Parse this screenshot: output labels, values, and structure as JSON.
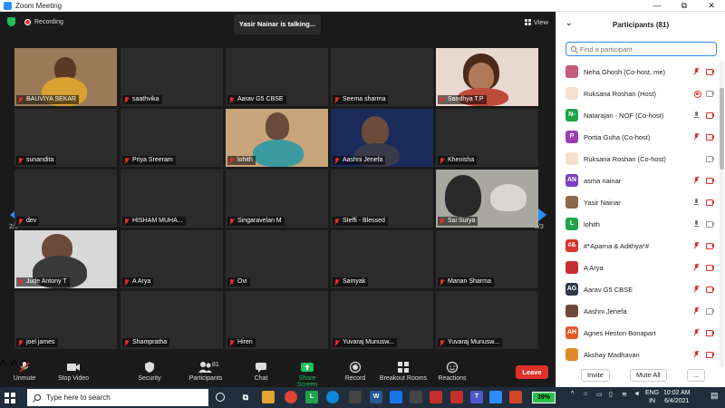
{
  "window": {
    "title": "Zoom Meeting",
    "ctrls": [
      "—",
      "⧉",
      "✕"
    ]
  },
  "meeting": {
    "recording_label": "Recording",
    "talking_banner": "Yasir Nainar is talking...",
    "view_label": "View",
    "page_left": "2/3",
    "page_right": "2/3"
  },
  "tiles": [
    {
      "name": "BAUVIYA SEKAR",
      "video": true
    },
    {
      "name": "saathvika",
      "video": false
    },
    {
      "name": "Aarav G5 CBSE",
      "video": false
    },
    {
      "name": "Seema sharma",
      "video": false
    },
    {
      "name": "Sandhya T.P",
      "video": true
    },
    {
      "name": "sunandita",
      "video": false
    },
    {
      "name": "Priya Sreeram",
      "video": false
    },
    {
      "name": "lohith",
      "video": true
    },
    {
      "name": "Aashni Jenefa",
      "video": true
    },
    {
      "name": "Khenisha",
      "video": false
    },
    {
      "name": "dev",
      "video": false
    },
    {
      "name": "HISHAM MUHA...",
      "video": false
    },
    {
      "name": "Singaravelan M",
      "video": false
    },
    {
      "name": "Steffi - Blessed",
      "video": false
    },
    {
      "name": "Sai Surya",
      "video": true
    },
    {
      "name": "Jude Antony T",
      "video": true
    },
    {
      "name": "A Arya",
      "video": false
    },
    {
      "name": "Ovi",
      "video": false
    },
    {
      "name": "Samyak",
      "video": false
    },
    {
      "name": "Manan Sharma",
      "video": false
    },
    {
      "name": "joel james",
      "video": false
    },
    {
      "name": "Shampratha",
      "video": false
    },
    {
      "name": "Hiren",
      "video": false
    },
    {
      "name": "Yuvaraj Munusw...",
      "video": false
    },
    {
      "name": "Yuvaraj Munusw...",
      "video": false
    }
  ],
  "toolbar": {
    "unmute": "Unmute",
    "stop_video": "Stop Video",
    "security": "Security",
    "participants": "Participants",
    "participants_count": "81",
    "chat": "Chat",
    "share_screen": "Share Screen",
    "record": "Record",
    "breakout": "Breakout Rooms",
    "reactions": "Reactions",
    "leave": "Leave"
  },
  "panel": {
    "title": "Participants (81)",
    "search_placeholder": "Find a participant",
    "invite": "Invite",
    "mute_all": "Mute All",
    "more": "...",
    "participants": [
      {
        "name": "Neha Ghosh (Co-host, me)",
        "avatar": "",
        "color": "#c75b7a",
        "mic": "red",
        "cam": "red"
      },
      {
        "name": "Ruksana Roshan (Host)",
        "avatar": "",
        "color": "#f6e0cc",
        "mic": "recdot",
        "cam": "gray"
      },
      {
        "name": "Natarajan - NOF (Co-host)",
        "avatar": "N-",
        "color": "#1fa34a",
        "mic": "gray",
        "cam": "red"
      },
      {
        "name": "Portia Guha (Co-host)",
        "avatar": "P",
        "color": "#9b3fb7",
        "mic": "red",
        "cam": "red"
      },
      {
        "name": "Ruksana Roshan (Co-host)",
        "avatar": "",
        "color": "#f6e0cc",
        "mic": "none",
        "cam": "gray"
      },
      {
        "name": "asma nainar",
        "avatar": "AN",
        "color": "#7b3fc4",
        "mic": "red",
        "cam": "red"
      },
      {
        "name": "Yasir Nainar",
        "avatar": "",
        "color": "#8a6a4a",
        "mic": "gray",
        "cam": "red"
      },
      {
        "name": "lohith",
        "avatar": "L",
        "color": "#1fa34a",
        "mic": "gray",
        "cam": "gray"
      },
      {
        "name": "#*Aparna & Adithya*#",
        "avatar": "#&",
        "color": "#d9352b",
        "mic": "red",
        "cam": "red"
      },
      {
        "name": "A Arya",
        "avatar": "",
        "color": "#c73030",
        "mic": "red",
        "cam": "red"
      },
      {
        "name": "Aarav G5 CBSE",
        "avatar": "AG",
        "color": "#2d3a4a",
        "mic": "red",
        "cam": "red"
      },
      {
        "name": "Aashni Jenefa",
        "avatar": "",
        "color": "#6b4a3a",
        "mic": "red",
        "cam": "gray"
      },
      {
        "name": "Agnes Heston Bonapart",
        "avatar": "AH",
        "color": "#e05a2b",
        "mic": "red",
        "cam": "red"
      },
      {
        "name": "Akshay Madhavan",
        "avatar": "",
        "color": "#e08a2b",
        "mic": "red",
        "cam": "red"
      }
    ]
  },
  "taskbar": {
    "search_placeholder": "Type here to search",
    "battery": "39%",
    "lang_top": "ENG",
    "lang_bottom": "IN",
    "time": "10:02 AM",
    "date": "6/4/2021",
    "tray": "^"
  },
  "colors": {
    "accent": "#2d8cff",
    "danger": "#e0302b",
    "share": "#1fbf5c",
    "background": "#1a1a1a"
  }
}
